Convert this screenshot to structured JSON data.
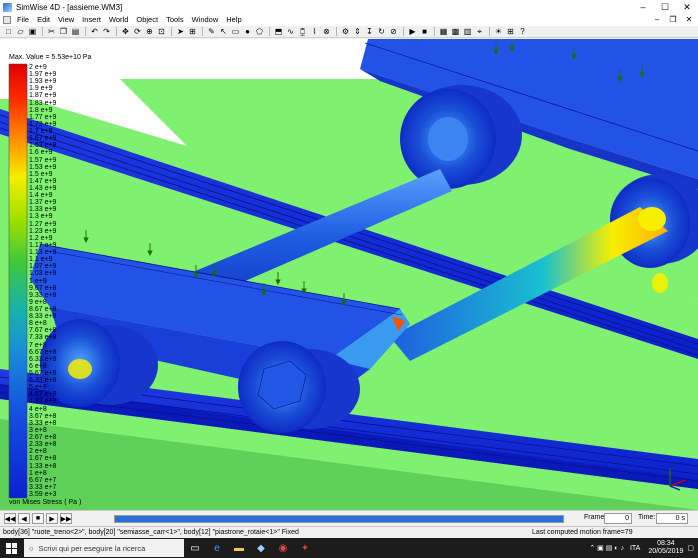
{
  "window": {
    "title": "SimWise 4D - [assieme.WM3]",
    "controls": {
      "minimize": "–",
      "maximize": "☐",
      "close": "✕"
    }
  },
  "menu": {
    "items": [
      "File",
      "Edit",
      "View",
      "Insert",
      "World",
      "Object",
      "Tools",
      "Window",
      "Help"
    ],
    "mdi_controls": {
      "minimize": "–",
      "restore": "❐",
      "close": "✕"
    }
  },
  "toolbar": {
    "icons": [
      "new-icon",
      "open-icon",
      "save-icon",
      "cut-icon",
      "copy-icon",
      "paste-icon",
      "undo-icon",
      "redo-icon",
      "move-icon",
      "rotate-icon",
      "zoom-icon",
      "fit-icon",
      "select-icon",
      "constraint-icon",
      "probe-icon",
      "arrow-icon",
      "rect-icon",
      "sphere-icon",
      "polygon-icon",
      "extrude-icon",
      "spring-icon",
      "damper-icon",
      "rope-icon",
      "joint-icon",
      "motor-icon",
      "actuator-icon",
      "force-icon",
      "torque-icon",
      "meter-icon",
      "play-icon",
      "stop-icon",
      "mesh-icon",
      "fea-icon",
      "plot-icon",
      "camera-icon",
      "light-icon",
      "grid-icon",
      "help-icon"
    ]
  },
  "legend": {
    "max_value": "Max. Value = 5.53e+10 Pa",
    "title": "von Mises Stress  ( Pa )",
    "labels": [
      "2     e+9",
      "1.97  e+9",
      "1.93  e+9",
      "1.9   e+9",
      "1.87  e+9",
      "1.83  e+9",
      "1.8   e+9",
      "1.77  e+9",
      "1.73  e+9",
      "1.7   e+9",
      "1.67  e+9",
      "1.63  e+9",
      "1.6   e+9",
      "1.57  e+9",
      "1.53  e+9",
      "1.5   e+9",
      "1.47  e+9",
      "1.43  e+9",
      "1.4   e+9",
      "1.37  e+9",
      "1.33  e+9",
      "1.3   e+9",
      "1.27  e+9",
      "1.23  e+9",
      "1.2   e+9",
      "1.17  e+9",
      "1.13  e+9",
      "1.1   e+9",
      "1.07  e+9",
      "1.03  e+9",
      "1     e+9",
      "9.67  e+8",
      "9.33  e+8",
      "9     e+8",
      "8.67  e+8",
      "8.33  e+8",
      "8     e+8",
      "7.67  e+8",
      "7.33  e+8",
      "7     e+8",
      "6.67  e+8",
      "6.33  e+8",
      "6     e+8",
      "5.67  e+8",
      "5.33  e+8",
      "5     e+8",
      "4.67  e+8",
      "4.33  e+8",
      "4     e+8",
      "3.67  e+8",
      "3.33  e+8",
      "3     e+8",
      "2.67  e+8",
      "2.33  e+8",
      "2     e+8",
      "1.67  e+8",
      "1.33  e+8",
      "1     e+8",
      "6.67  e+7",
      "3.33  e+7",
      "3.59  e+3"
    ]
  },
  "playback": {
    "buttons": [
      "rewind",
      "step-back",
      "stop",
      "step-forward",
      "play"
    ],
    "progress": 1.0,
    "frame_label": "Frame:",
    "frame_value": "0",
    "time_label": "Time:",
    "time_value": "0 s"
  },
  "status": {
    "left": "body[36] \"ruote_treno<2>\", body[20] \"semiasse_carr<1>\", body[12] \"piastrone_rotaie<1>\"  Fixed",
    "right": "Last computed motion frame=79"
  },
  "taskbar": {
    "search_placeholder": "Scrivi qui per eseguire la ricerca",
    "language": "ITA",
    "time": "08:34",
    "date": "20/05/2019"
  },
  "colors": {
    "legend_red": "#e00000",
    "legend_orange": "#ff8a00",
    "legend_yellow": "#f6ef00",
    "legend_green": "#3ec63e",
    "legend_cyan": "#19b4c8",
    "legend_blue": "#0b22d0",
    "background_plate": "#80f070"
  }
}
